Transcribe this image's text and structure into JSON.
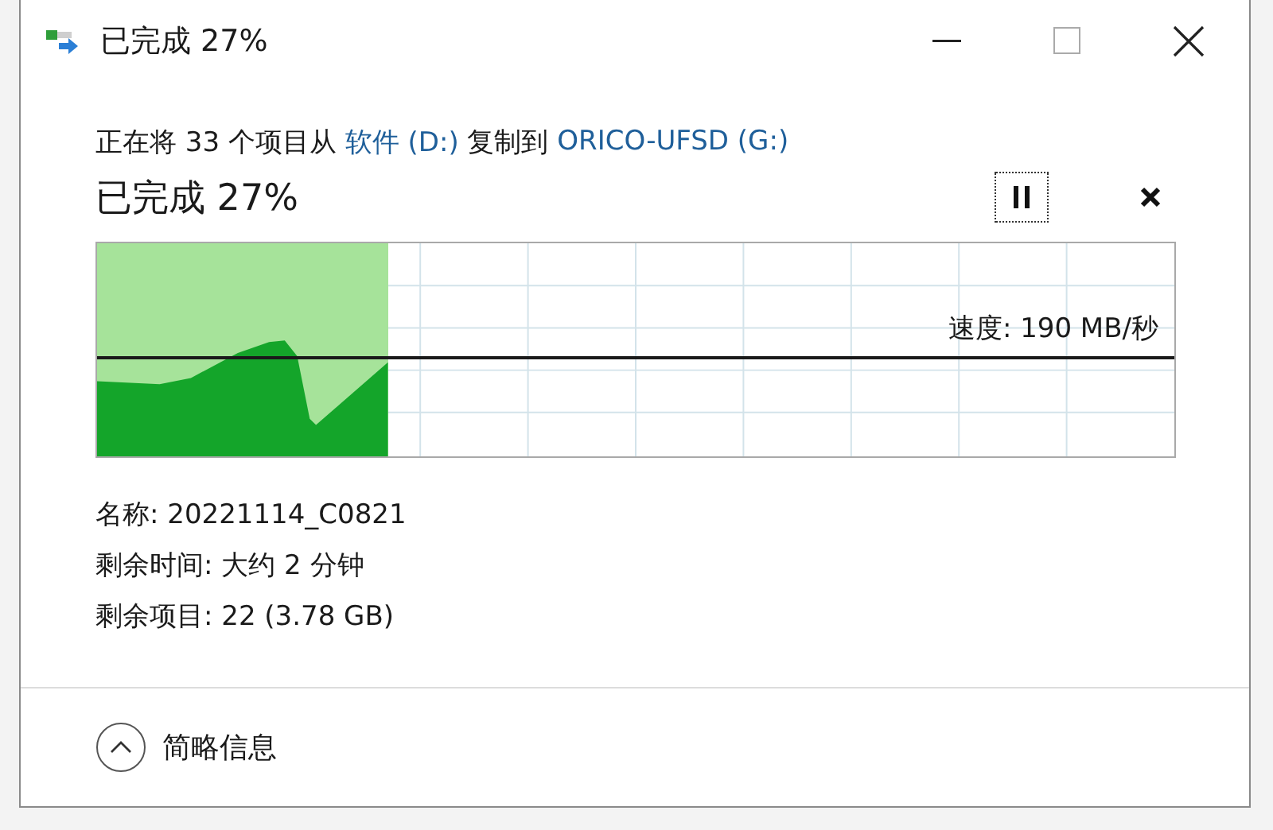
{
  "window": {
    "title": "已完成 27%"
  },
  "header": {
    "parts": [
      {
        "kind": "plain",
        "text": "正在将 33 个项目从 "
      },
      {
        "kind": "link",
        "text": "软件 (D:)"
      },
      {
        "kind": "plain",
        "text": " 复制到 "
      },
      {
        "kind": "link",
        "text": "ORICO-UFSD (G:)"
      }
    ]
  },
  "progress": {
    "title": "已完成 27%",
    "level": 0.27,
    "speed": "速度: 190 MB/秒"
  },
  "details": [
    "名称: 20221114_C0821",
    "剩余时间: 大约 2 分钟",
    "剩余项目: 22 (3.78 GB)"
  ],
  "footer": {
    "toggle": "简略信息",
    "expanded": true
  }
}
